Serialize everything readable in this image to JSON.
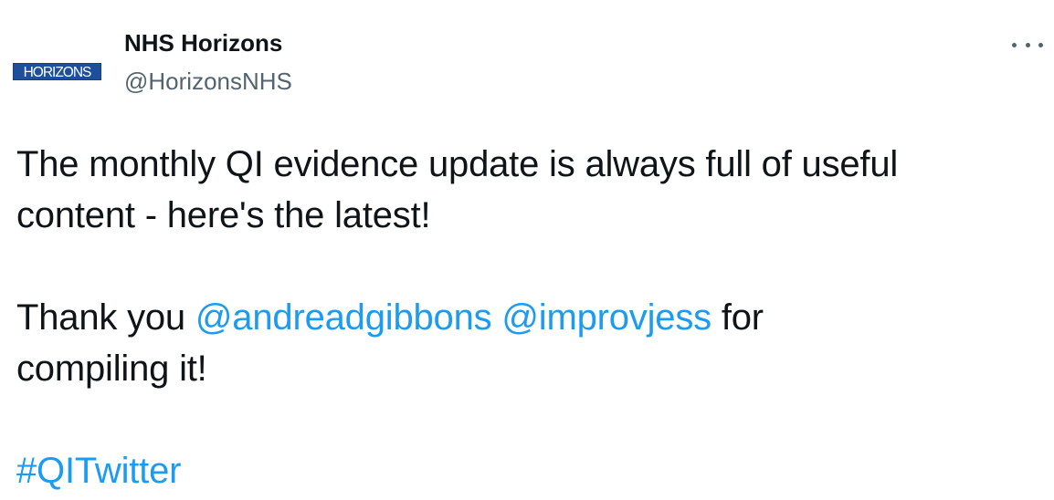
{
  "account": {
    "logo_text": "HORIZONS",
    "display_name": "NHS Horizons",
    "handle": "@HorizonsNHS"
  },
  "tweet": {
    "line1": "The monthly QI evidence update is always full of useful",
    "line2": "content - here's the latest!",
    "thanks_prefix": "Thank you",
    "mention1": "@andreadgibbons",
    "mention2": "@improvjess",
    "thanks_suffix": "for",
    "line4": "compiling it!",
    "hashtag": "#QITwitter"
  },
  "colors": {
    "link": "#1d9bf0",
    "text": "#0f1419",
    "secondary": "#536471",
    "logo_bg": "#1d4f9c"
  },
  "icons": {
    "more": "more-horizontal-icon"
  }
}
